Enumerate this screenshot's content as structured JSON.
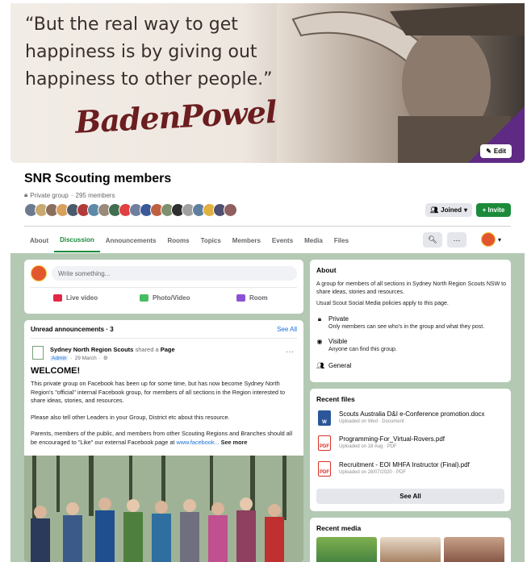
{
  "cover": {
    "quote": "“But the real way to get happiness is by giving out happiness to other people.”",
    "signature": "BadenPowell",
    "edit_label": "Edit"
  },
  "group": {
    "title": "SNR Scouting members",
    "privacy": "Private group",
    "members": "295 members",
    "joined_label": "Joined",
    "invite_label": "+ Invite",
    "member_avatar_colors": [
      "#6b7a8f",
      "#c8a96e",
      "#8b6f5e",
      "#d9a05b",
      "#4a5a6a",
      "#b33a3a",
      "#5d8aa8",
      "#9a8a7a",
      "#3f6f4f",
      "#e04040",
      "#6f7f9f",
      "#3b5998",
      "#c06040",
      "#7f8f6f",
      "#2f2f2f",
      "#a0a0a0",
      "#5f7f9f",
      "#e0b040",
      "#4f4f6f",
      "#8f5f5f"
    ]
  },
  "nav": {
    "tabs": [
      "About",
      "Discussion",
      "Announcements",
      "Rooms",
      "Topics",
      "Members",
      "Events",
      "Media",
      "Files"
    ],
    "active_tab": "Discussion"
  },
  "composer": {
    "placeholder": "Write something...",
    "actions": [
      "Live video",
      "Photo/Video",
      "Room"
    ]
  },
  "announcements": {
    "title": "Unread announcements · 3",
    "see_all": "See All",
    "poster": "Sydney North Region Scouts",
    "shared": "shared a",
    "object": "Page",
    "role": "Admin",
    "date": "29 March",
    "heading": "WELCOME!",
    "paragraph1": "This private group on Facebook has been up for some time, but has now become Sydney North Region's \"official\" internal Facebook group, for members of all sections in the Region interested to share ideas, stories, and resources.",
    "paragraph2": "Please also tell other Leaders in your Group, District etc about this resource.",
    "paragraph3": "Parents, members of the public, and members from other Scouting Regions and Branches should all be encouraged to \"Like\" our external Facebook page at",
    "link": "www.facebook...",
    "see_more": "See more"
  },
  "about": {
    "title": "About",
    "description": "A group for members of all sections in Sydney North Region Scouts NSW to share ideas, stories and resources.",
    "rules": "Usual Scout Social Media policies apply to this page.",
    "private_title": "Private",
    "private_desc": "Only members can see who's in the group and what they post.",
    "visible_title": "Visible",
    "visible_desc": "Anyone can find this group.",
    "general": "General"
  },
  "files": {
    "title": "Recent files",
    "items": [
      {
        "name": "Scouts Australia D&I e-Conference promotion.docx",
        "meta": "Uploaded on Wed · Document",
        "type": "W"
      },
      {
        "name": "Programming-For_Virtual-Rovers.pdf",
        "meta": "Uploaded on 18 Aug · PDF",
        "type": "PDF"
      },
      {
        "name": "Recruitment - EOI MHFA Instructor (Final).pdf",
        "meta": "Uploaded on 28/07/2020 · PDF",
        "type": "PDF"
      }
    ],
    "see_all": "See All"
  },
  "media": {
    "title": "Recent media"
  }
}
